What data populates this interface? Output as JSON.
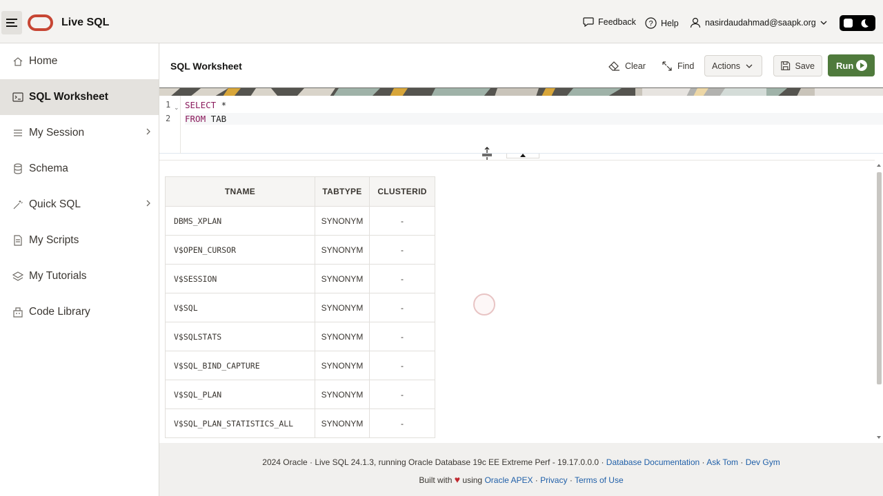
{
  "header": {
    "app_title": "Live SQL",
    "feedback": "Feedback",
    "help": "Help",
    "user": "nasirdaudahmad@saapk.org"
  },
  "sidebar": {
    "items": [
      {
        "label": "Home",
        "icon": "home-icon"
      },
      {
        "label": "SQL Worksheet",
        "icon": "terminal-icon",
        "active": true
      },
      {
        "label": "My Session",
        "icon": "list-icon",
        "chevron": true
      },
      {
        "label": "Schema",
        "icon": "database-icon"
      },
      {
        "label": "Quick SQL",
        "icon": "wand-icon",
        "chevron": true
      },
      {
        "label": "My Scripts",
        "icon": "document-icon"
      },
      {
        "label": "My Tutorials",
        "icon": "layers-icon"
      },
      {
        "label": "Code Library",
        "icon": "building-icon"
      }
    ]
  },
  "worksheet": {
    "title": "SQL Worksheet",
    "clear": "Clear",
    "find": "Find",
    "actions": "Actions",
    "save": "Save",
    "run": "Run"
  },
  "editor": {
    "lines": [
      {
        "num": "1",
        "kw": "SELECT",
        "rest": " *"
      },
      {
        "num": "2",
        "kw": "FROM",
        "rest": " TAB"
      }
    ]
  },
  "results": {
    "columns": [
      "TNAME",
      "TABTYPE",
      "CLUSTERID"
    ],
    "rows": [
      [
        "DBMS_XPLAN",
        "SYNONYM",
        "-"
      ],
      [
        "V$OPEN_CURSOR",
        "SYNONYM",
        "-"
      ],
      [
        "V$SESSION",
        "SYNONYM",
        "-"
      ],
      [
        "V$SQL",
        "SYNONYM",
        "-"
      ],
      [
        "V$SQLSTATS",
        "SYNONYM",
        "-"
      ],
      [
        "V$SQL_BIND_CAPTURE",
        "SYNONYM",
        "-"
      ],
      [
        "V$SQL_PLAN",
        "SYNONYM",
        "-"
      ],
      [
        "V$SQL_PLAN_STATISTICS_ALL",
        "SYNONYM",
        "-"
      ]
    ]
  },
  "footer": {
    "line1_text": "2024 Oracle · Live SQL 24.1.3, running Oracle Database 19c EE Extreme Perf - 19.17.0.0.0 · ",
    "link_docs": "Database Documentation",
    "sep": " · ",
    "link_asktom": "Ask Tom",
    "link_devgym": "Dev Gym",
    "built_with": "Built with",
    "using": "using",
    "link_apex": "Oracle APEX",
    "link_privacy": "Privacy",
    "link_terms": "Terms of Use"
  },
  "colors": {
    "run_button": "#4f7a3c",
    "oracle_red": "#c74634",
    "link": "#1f5fa8"
  }
}
